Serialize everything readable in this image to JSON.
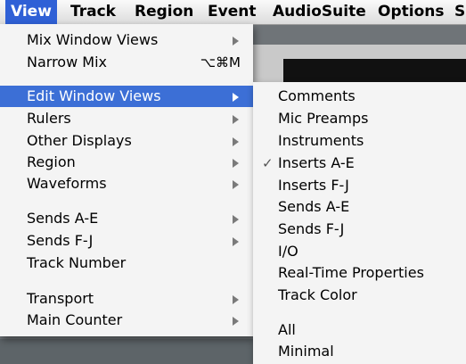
{
  "menubar": {
    "items": [
      "View",
      "Track",
      "Region",
      "Event",
      "AudioSuite",
      "Options",
      "S"
    ]
  },
  "view_menu": {
    "items": [
      {
        "label": "Mix Window Views",
        "submenu": true
      },
      {
        "label": "Narrow Mix",
        "shortcut": "⌥⌘M"
      },
      {
        "label": "Edit Window Views",
        "submenu": true,
        "highlighted": true
      },
      {
        "label": "Rulers",
        "submenu": true
      },
      {
        "label": "Other Displays",
        "submenu": true
      },
      {
        "label": "Region",
        "submenu": true
      },
      {
        "label": "Waveforms",
        "submenu": true
      },
      {
        "label": "Sends A-E",
        "submenu": true
      },
      {
        "label": "Sends F-J",
        "submenu": true
      },
      {
        "label": "Track Number"
      },
      {
        "label": "Transport",
        "submenu": true
      },
      {
        "label": "Main Counter",
        "submenu": true
      }
    ]
  },
  "edit_window_views_submenu": {
    "items": [
      {
        "label": "Comments"
      },
      {
        "label": "Mic Preamps"
      },
      {
        "label": "Instruments"
      },
      {
        "label": "Inserts A-E",
        "checked": true,
        "check_glyph": "✓"
      },
      {
        "label": "Inserts F-J"
      },
      {
        "label": "Sends A-E"
      },
      {
        "label": "Sends F-J"
      },
      {
        "label": "I/O"
      },
      {
        "label": "Real-Time Properties"
      },
      {
        "label": "Track Color"
      },
      {
        "label": "All"
      },
      {
        "label": "Minimal"
      }
    ]
  },
  "colors": {
    "menu_highlight": "#3c6fd6",
    "menubar_active": "#2f60d6",
    "menu_background": "#f4f4f4"
  }
}
